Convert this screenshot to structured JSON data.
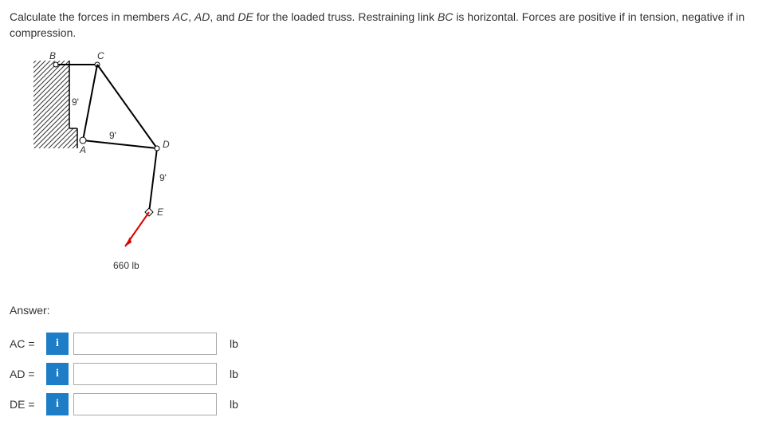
{
  "problem": {
    "text_1": "Calculate the forces in members ",
    "m1": "AC",
    "text_2": ", ",
    "m2": "AD",
    "text_3": ", and ",
    "m3": "DE",
    "text_4": " for the loaded truss. Restraining link ",
    "m4": "BC",
    "text_5": " is horizontal. Forces are positive if in tension, negative if in compression."
  },
  "diagram": {
    "B": "B",
    "C": "C",
    "A": "A",
    "D": "D",
    "E": "E",
    "dim1": "9'",
    "dim2": "9'",
    "dim3": "9'",
    "load": "660 lb"
  },
  "answer": {
    "header": "Answer:",
    "rows": [
      {
        "label": "AC =",
        "value": "",
        "unit": "lb"
      },
      {
        "label": "AD =",
        "value": "",
        "unit": "lb"
      },
      {
        "label": "DE =",
        "value": "",
        "unit": "lb"
      }
    ],
    "info_icon": "i"
  }
}
